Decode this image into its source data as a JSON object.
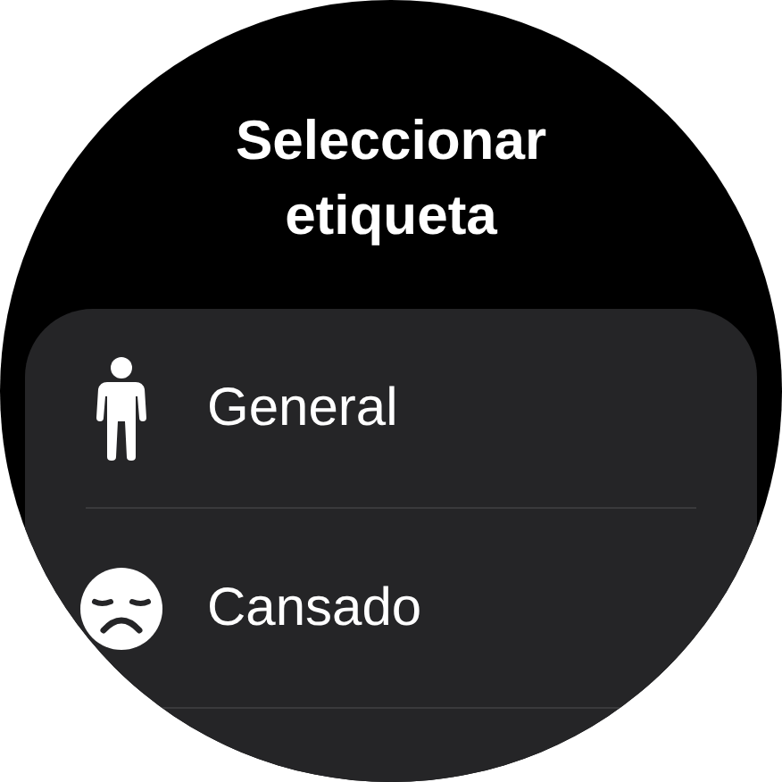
{
  "title": "Seleccionar etiqueta",
  "items": [
    {
      "label": "General",
      "kind": "person"
    },
    {
      "label": "Cansado",
      "kind": "sad"
    }
  ]
}
